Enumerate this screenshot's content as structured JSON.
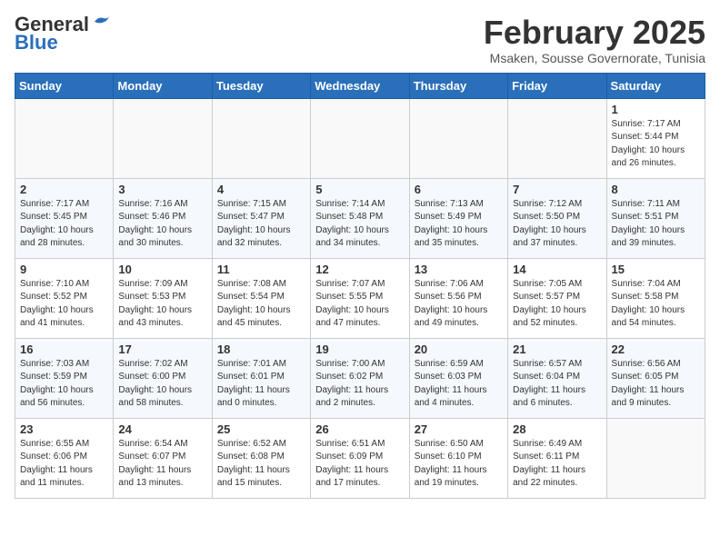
{
  "header": {
    "logo_general": "General",
    "logo_blue": "Blue",
    "month_year": "February 2025",
    "location": "Msaken, Sousse Governorate, Tunisia"
  },
  "weekdays": [
    "Sunday",
    "Monday",
    "Tuesday",
    "Wednesday",
    "Thursday",
    "Friday",
    "Saturday"
  ],
  "weeks": [
    [
      {
        "day": "",
        "info": ""
      },
      {
        "day": "",
        "info": ""
      },
      {
        "day": "",
        "info": ""
      },
      {
        "day": "",
        "info": ""
      },
      {
        "day": "",
        "info": ""
      },
      {
        "day": "",
        "info": ""
      },
      {
        "day": "1",
        "info": "Sunrise: 7:17 AM\nSunset: 5:44 PM\nDaylight: 10 hours and 26 minutes."
      }
    ],
    [
      {
        "day": "2",
        "info": "Sunrise: 7:17 AM\nSunset: 5:45 PM\nDaylight: 10 hours and 28 minutes."
      },
      {
        "day": "3",
        "info": "Sunrise: 7:16 AM\nSunset: 5:46 PM\nDaylight: 10 hours and 30 minutes."
      },
      {
        "day": "4",
        "info": "Sunrise: 7:15 AM\nSunset: 5:47 PM\nDaylight: 10 hours and 32 minutes."
      },
      {
        "day": "5",
        "info": "Sunrise: 7:14 AM\nSunset: 5:48 PM\nDaylight: 10 hours and 34 minutes."
      },
      {
        "day": "6",
        "info": "Sunrise: 7:13 AM\nSunset: 5:49 PM\nDaylight: 10 hours and 35 minutes."
      },
      {
        "day": "7",
        "info": "Sunrise: 7:12 AM\nSunset: 5:50 PM\nDaylight: 10 hours and 37 minutes."
      },
      {
        "day": "8",
        "info": "Sunrise: 7:11 AM\nSunset: 5:51 PM\nDaylight: 10 hours and 39 minutes."
      }
    ],
    [
      {
        "day": "9",
        "info": "Sunrise: 7:10 AM\nSunset: 5:52 PM\nDaylight: 10 hours and 41 minutes."
      },
      {
        "day": "10",
        "info": "Sunrise: 7:09 AM\nSunset: 5:53 PM\nDaylight: 10 hours and 43 minutes."
      },
      {
        "day": "11",
        "info": "Sunrise: 7:08 AM\nSunset: 5:54 PM\nDaylight: 10 hours and 45 minutes."
      },
      {
        "day": "12",
        "info": "Sunrise: 7:07 AM\nSunset: 5:55 PM\nDaylight: 10 hours and 47 minutes."
      },
      {
        "day": "13",
        "info": "Sunrise: 7:06 AM\nSunset: 5:56 PM\nDaylight: 10 hours and 49 minutes."
      },
      {
        "day": "14",
        "info": "Sunrise: 7:05 AM\nSunset: 5:57 PM\nDaylight: 10 hours and 52 minutes."
      },
      {
        "day": "15",
        "info": "Sunrise: 7:04 AM\nSunset: 5:58 PM\nDaylight: 10 hours and 54 minutes."
      }
    ],
    [
      {
        "day": "16",
        "info": "Sunrise: 7:03 AM\nSunset: 5:59 PM\nDaylight: 10 hours and 56 minutes."
      },
      {
        "day": "17",
        "info": "Sunrise: 7:02 AM\nSunset: 6:00 PM\nDaylight: 10 hours and 58 minutes."
      },
      {
        "day": "18",
        "info": "Sunrise: 7:01 AM\nSunset: 6:01 PM\nDaylight: 11 hours and 0 minutes."
      },
      {
        "day": "19",
        "info": "Sunrise: 7:00 AM\nSunset: 6:02 PM\nDaylight: 11 hours and 2 minutes."
      },
      {
        "day": "20",
        "info": "Sunrise: 6:59 AM\nSunset: 6:03 PM\nDaylight: 11 hours and 4 minutes."
      },
      {
        "day": "21",
        "info": "Sunrise: 6:57 AM\nSunset: 6:04 PM\nDaylight: 11 hours and 6 minutes."
      },
      {
        "day": "22",
        "info": "Sunrise: 6:56 AM\nSunset: 6:05 PM\nDaylight: 11 hours and 9 minutes."
      }
    ],
    [
      {
        "day": "23",
        "info": "Sunrise: 6:55 AM\nSunset: 6:06 PM\nDaylight: 11 hours and 11 minutes."
      },
      {
        "day": "24",
        "info": "Sunrise: 6:54 AM\nSunset: 6:07 PM\nDaylight: 11 hours and 13 minutes."
      },
      {
        "day": "25",
        "info": "Sunrise: 6:52 AM\nSunset: 6:08 PM\nDaylight: 11 hours and 15 minutes."
      },
      {
        "day": "26",
        "info": "Sunrise: 6:51 AM\nSunset: 6:09 PM\nDaylight: 11 hours and 17 minutes."
      },
      {
        "day": "27",
        "info": "Sunrise: 6:50 AM\nSunset: 6:10 PM\nDaylight: 11 hours and 19 minutes."
      },
      {
        "day": "28",
        "info": "Sunrise: 6:49 AM\nSunset: 6:11 PM\nDaylight: 11 hours and 22 minutes."
      },
      {
        "day": "",
        "info": ""
      }
    ]
  ]
}
